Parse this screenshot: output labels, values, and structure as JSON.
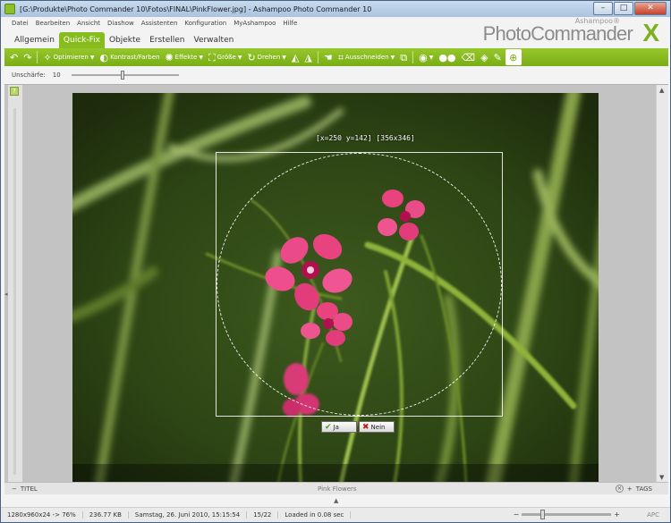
{
  "window": {
    "title": "[G:\\Produkte\\Photo Commander 10\\Fotos\\FINAL\\PinkFlower.jpg] - Ashampoo Photo Commander 10",
    "minimize_glyph": "–",
    "maximize_glyph": "□",
    "close_glyph": "✕"
  },
  "menu": [
    "Datei",
    "Bearbeiten",
    "Ansicht",
    "Diashow",
    "Assistenten",
    "Konfiguration",
    "MyAshampoo",
    "Hilfe"
  ],
  "logo": {
    "sub": "Ashampoo®",
    "main": "PhotoCommander",
    "mark": "X"
  },
  "tabs": [
    "Allgemein",
    "Quick-Fix",
    "Objekte",
    "Erstellen",
    "Verwalten"
  ],
  "toolbar": {
    "optimize": "Optimieren",
    "contrast": "Kontrast/Farben",
    "effects": "Effekte",
    "size": "Größe",
    "rotate": "Drehen",
    "crop": "Ausschneiden"
  },
  "options": {
    "sharpness_label": "Unschärfe:",
    "sharpness_value": "10",
    "sharpness_level": 0.48
  },
  "selection": {
    "readout": "[x=250 y=142] [356x346]",
    "yes": "Ja",
    "no": "Nein"
  },
  "caption": {
    "title_label": "TITEL",
    "image_title": "Pink Flowers",
    "tags_label": "TAGS"
  },
  "status": {
    "dimensions": "1280x960x24 -> 76%",
    "file_size": "236.77 KB",
    "date": "Samstag, 26. Juni 2010, 15:15:54",
    "position": "15/22",
    "load_time": "Loaded in 0.08 sec",
    "zoom_minus": "−",
    "zoom_plus": "+",
    "zoom_level": 0.22,
    "brand": "APC"
  },
  "colors": {
    "accent": "#86bc1c",
    "toolbar": "#7aad16",
    "flower": "#e8427f"
  }
}
